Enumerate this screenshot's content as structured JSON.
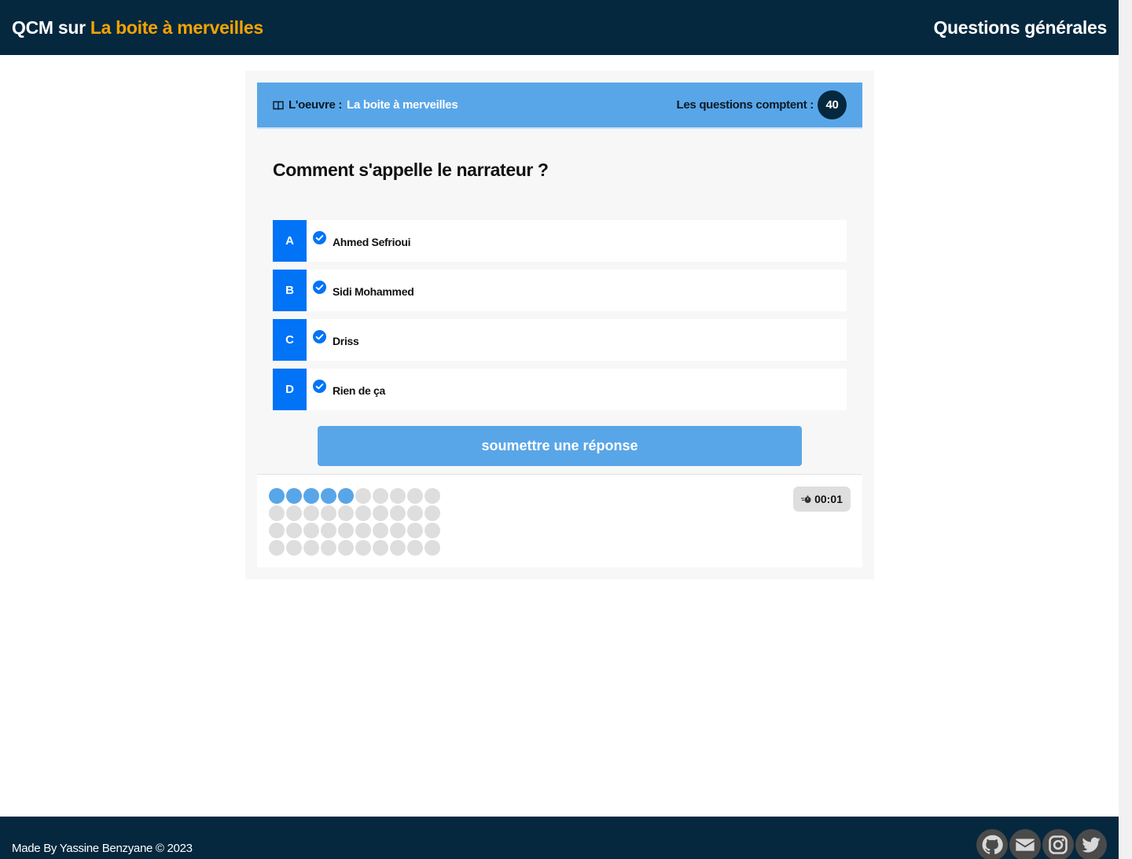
{
  "header": {
    "brand_prefix": "QCM sur",
    "brand_work": "La boite à merveilles",
    "section": "Questions générales"
  },
  "quiz": {
    "work_label": "L'oeuvre :",
    "work_title": "La boite à merveilles",
    "count_label": "Les questions comptent :",
    "count": "40",
    "question": "Comment s'appelle le narrateur ?",
    "answers": [
      {
        "letter": "A",
        "text": "Ahmed Sefrioui"
      },
      {
        "letter": "B",
        "text": "Sidi Mohammed"
      },
      {
        "letter": "C",
        "text": "Driss"
      },
      {
        "letter": "D",
        "text": "Rien de ça"
      }
    ],
    "submit_label": "soumettre une réponse",
    "progress": {
      "total": 40,
      "completed": 5
    },
    "timer": "00:01"
  },
  "footer": {
    "credit": "Made By Yassine Benzyane © 2023",
    "socials": [
      "github-icon",
      "envelope-icon",
      "instagram-icon",
      "twitter-icon"
    ]
  },
  "colors": {
    "navy": "#05283e",
    "accent_orange": "#f5a300",
    "light_blue": "#58a6e8",
    "answer_blue": "#0073f7"
  }
}
